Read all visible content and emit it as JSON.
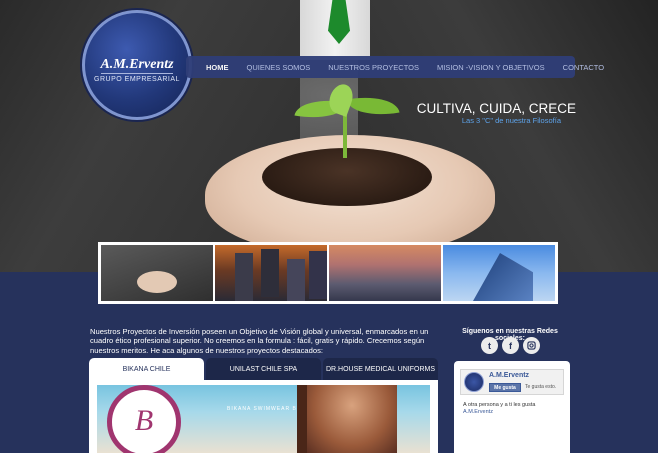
{
  "logo": {
    "name": "A.M.Erventz",
    "subtitle": "GRUPO EMPRESARIAL"
  },
  "nav": {
    "items": [
      {
        "label": "HOME",
        "active": true
      },
      {
        "label": "QUIENES SOMOS",
        "active": false
      },
      {
        "label": "NUESTROS PROYECTOS",
        "active": false
      },
      {
        "label": "MISION -VISION Y OBJETIVOS",
        "active": false
      },
      {
        "label": "CONTACTO",
        "active": false
      }
    ]
  },
  "hero": {
    "title": "CULTIVA, CUIDA, CRECE",
    "subtitle": "Las 3 \"C\" de nuestra Filosofía"
  },
  "intro": "Nuestros Proyectos de Inversión poseen un Objetivo de Visión global y universal, enmarcados en un cuadro ético profesional superior. No creemos en la formula : fácil, gratis y rápido. Crecemos según nuestros meritos. He aca algunos de nuestros proyectos destacados:",
  "social": {
    "title": "Síguenos en nuestras Redes sociales:",
    "icons": [
      "twitter-icon",
      "facebook-icon",
      "instagram-icon"
    ]
  },
  "tabs": [
    {
      "label": "BIKANA CHILE",
      "active": true
    },
    {
      "label": "UNILAST CHILE SPA",
      "active": false
    },
    {
      "label": "DR.HOUSE MEDICAL UNIFORMS",
      "active": false
    }
  ],
  "banner": {
    "text": "BIKANA SWIMWEAR BY ANAEVELI"
  },
  "facebook": {
    "page_name": "A.M.Erventz",
    "like_button": "Me gusta",
    "like_text": "Te gusta esto.",
    "friends_text": "A otra persona y a ti les gusta",
    "friends_link": "A.M.Erventz"
  },
  "colors": {
    "page_bg": "#26325c",
    "nav_bg": "#2f3e78",
    "accent_blue": "#5ea3ea",
    "tab_dark": "#1d2749"
  }
}
